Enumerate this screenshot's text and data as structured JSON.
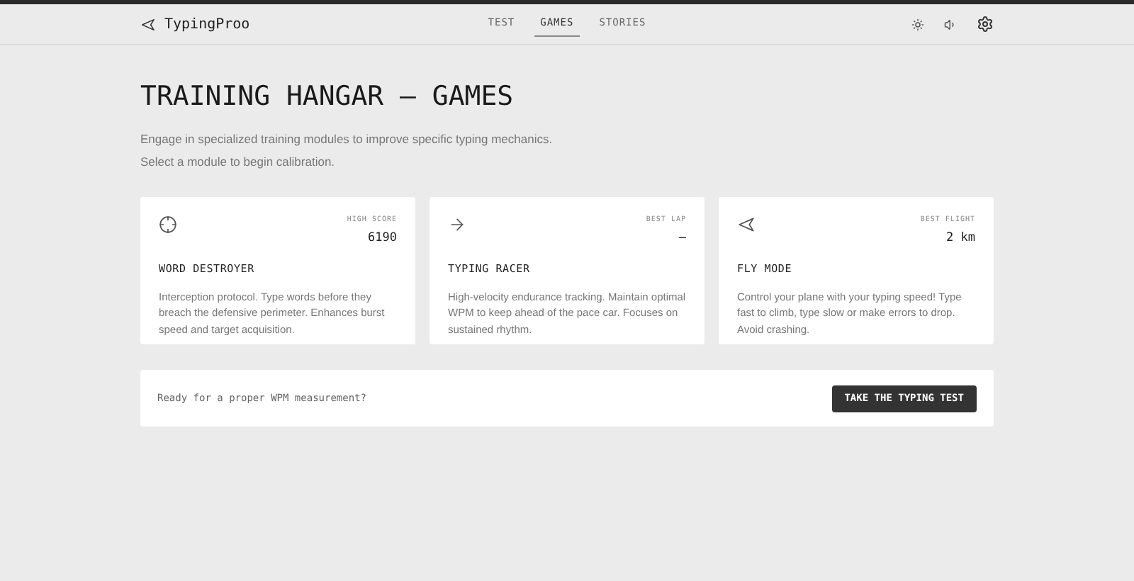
{
  "brand": {
    "name": "TypingProo"
  },
  "nav": [
    {
      "label": "TEST",
      "selected": false
    },
    {
      "label": "GAMES",
      "selected": true
    },
    {
      "label": "STORIES",
      "selected": false
    }
  ],
  "page": {
    "title": "TRAINING HANGAR — GAMES",
    "subtitle_lines": [
      "Engage in specialized training modules to improve specific typing mechanics.",
      "Select a module to begin calibration."
    ]
  },
  "games": [
    {
      "kind": "target",
      "stat_label": "HIGH SCORE",
      "stat_value": "6190",
      "title": "WORD DESTROYER",
      "description": "Interception protocol. Type words before they breach the defensive perimeter. Enhances burst speed and target acquisition."
    },
    {
      "kind": "arrow",
      "stat_label": "BEST LAP",
      "stat_value": "—",
      "title": "TYPING RACER",
      "description": "High-velocity endurance tracking. Maintain optimal WPM to keep ahead of the pace car. Focuses on sustained rhythm."
    },
    {
      "kind": "plane",
      "stat_label": "BEST FLIGHT",
      "stat_value": "2 km",
      "title": "FLY MODE",
      "description": "Control your plane with your typing speed! Type fast to climb, type slow or make errors to drop. Avoid crashing."
    }
  ],
  "cta": {
    "text": "Ready for a proper WPM measurement?",
    "button": "TAKE THE TYPING TEST"
  }
}
